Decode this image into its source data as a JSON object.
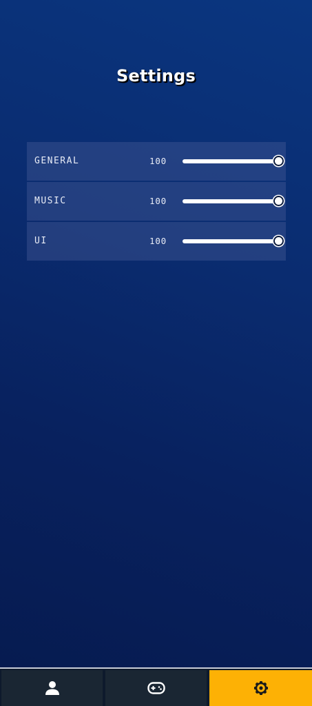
{
  "page": {
    "title": "Settings"
  },
  "settings": {
    "items": [
      {
        "label": "GENERAL",
        "value": "100",
        "level": 1.0
      },
      {
        "label": "MUSIC",
        "value": "100",
        "level": 1.0
      },
      {
        "label": "UI",
        "value": "100",
        "level": 1.0
      }
    ]
  },
  "navbar": {
    "items": [
      {
        "icon": "person-icon",
        "active": false
      },
      {
        "icon": "gamepad-icon",
        "active": false
      },
      {
        "icon": "gear-icon",
        "active": true
      }
    ],
    "active_color": "#fdb105",
    "inactive_color": "#1a2633"
  },
  "colors": {
    "background": "#0a2c70",
    "row_background": "#3b4f8c",
    "text": "#ffffff"
  }
}
